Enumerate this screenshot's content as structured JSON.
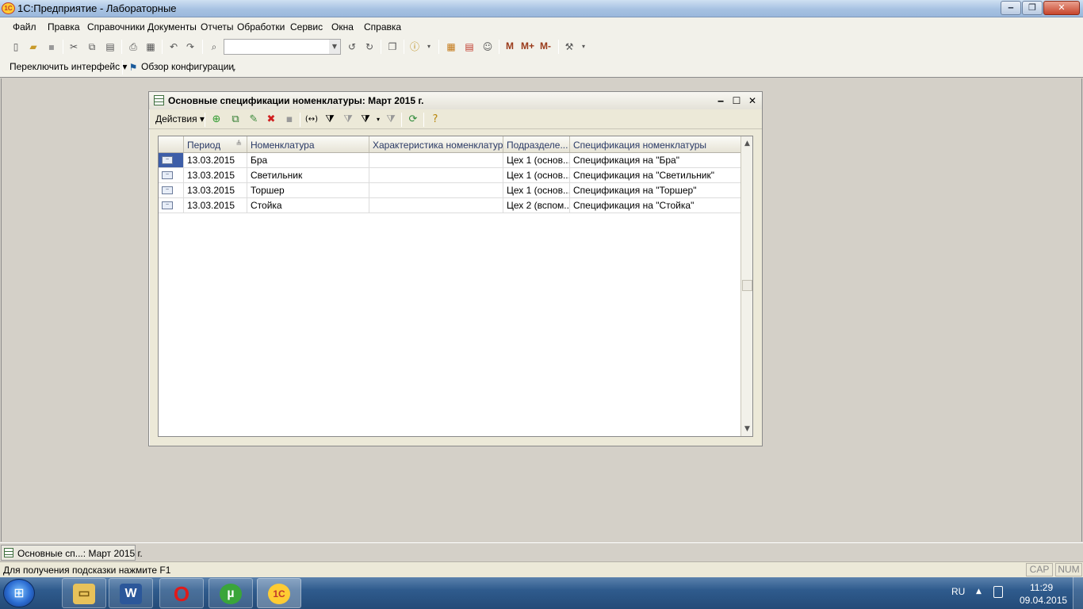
{
  "window": {
    "title": "1С:Предприятие - Лабораторные",
    "logo_text": "1С"
  },
  "menu": [
    "Файл",
    "Правка",
    "Справочники",
    "Документы",
    "Отчеты",
    "Обработки",
    "Сервис",
    "Окна",
    "Справка"
  ],
  "toolbar2": {
    "switch_interface": "Переключить интерфейс ▾",
    "config_overview": "Обзор конфигурации"
  },
  "toolbar1": {
    "m": "M",
    "m_plus": "M+",
    "m_minus": "M-",
    "search_value": ""
  },
  "child_window": {
    "title": "Основные спецификации номенклатуры: Март 2015 г.",
    "actions_label": "Действия ▾"
  },
  "table": {
    "columns": [
      "Период",
      "Номенклатура",
      "Характеристика номенклатуры",
      "Подразделе...",
      "Спецификация номенклатуры"
    ],
    "rows": [
      {
        "period": "13.03.2015",
        "item": "Бра",
        "characteristic": "",
        "department": "Цех 1 (основ...",
        "spec": "Спецификация на \"Бра\""
      },
      {
        "period": "13.03.2015",
        "item": "Светильник",
        "characteristic": "",
        "department": "Цех 1 (основ...",
        "spec": "Спецификация на \"Светильник\""
      },
      {
        "period": "13.03.2015",
        "item": "Торшер",
        "characteristic": "",
        "department": "Цех 1 (основ...",
        "spec": "Спецификация на \"Торшер\""
      },
      {
        "period": "13.03.2015",
        "item": "Стойка",
        "characteristic": "",
        "department": "Цех 2 (вспом...",
        "spec": "Спецификация на \"Стойка\""
      }
    ]
  },
  "windowbar": {
    "task_label": "Основные сп...: Март 2015 г."
  },
  "statusbar": {
    "hint": "Для получения подсказки нажмите F1",
    "cap": "CAP",
    "num": "NUM"
  },
  "taskbar": {
    "apps": [
      "Проводник",
      "Microsoft Word",
      "Opera",
      "uTorrent",
      "1С:Предприятие"
    ],
    "lang": "RU",
    "time": "11:29",
    "date": "09.04.2015"
  },
  "colors": {
    "selection": "#3d5ea8",
    "header_text": "#2a3a66",
    "taskbar": "#2f5b8d"
  }
}
